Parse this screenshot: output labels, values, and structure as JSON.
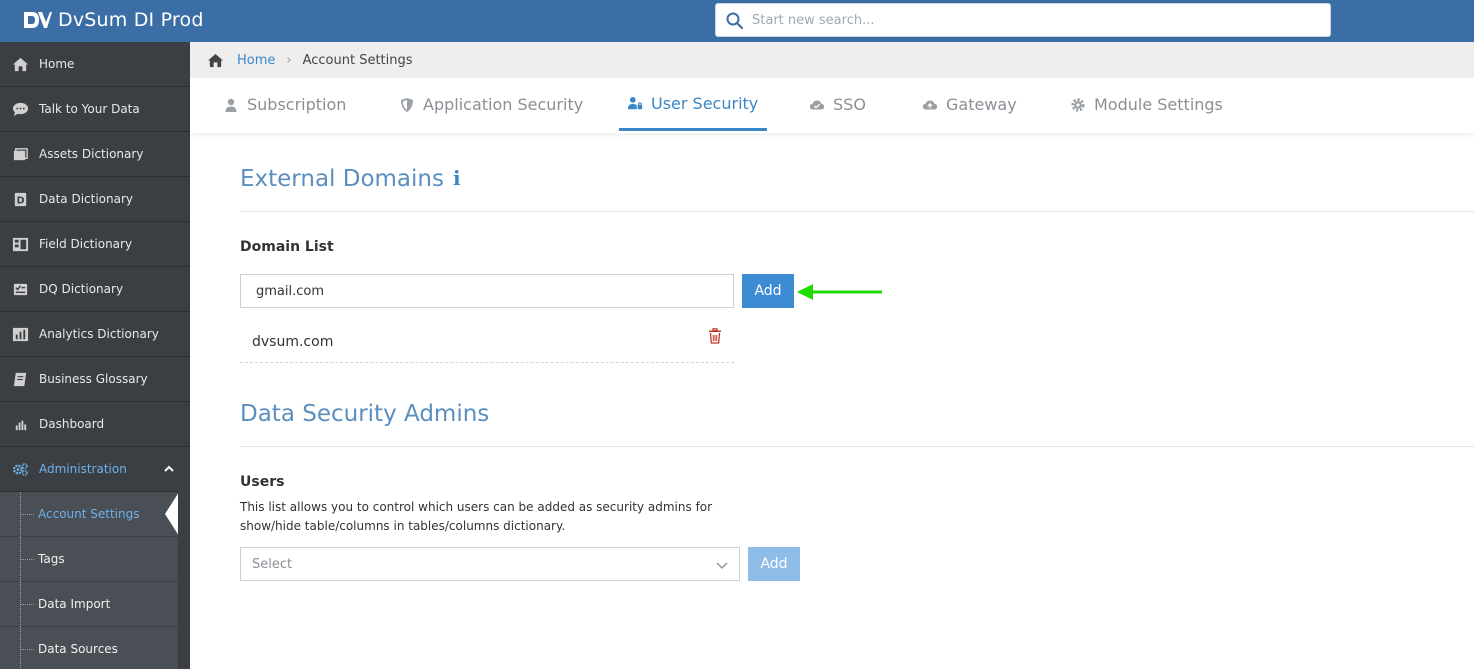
{
  "header": {
    "brand_title": "DvSum DI Prod",
    "search_placeholder": "Start new search..."
  },
  "sidebar": {
    "items": [
      {
        "label": "Home",
        "icon": "home-icon"
      },
      {
        "label": "Talk to Your Data",
        "icon": "chat-icon"
      },
      {
        "label": "Assets Dictionary",
        "icon": "assets-icon"
      },
      {
        "label": "Data Dictionary",
        "icon": "data-dictionary-icon"
      },
      {
        "label": "Field Dictionary",
        "icon": "field-dictionary-icon"
      },
      {
        "label": "DQ Dictionary",
        "icon": "dq-icon"
      },
      {
        "label": "Analytics Dictionary",
        "icon": "analytics-icon"
      },
      {
        "label": "Business Glossary",
        "icon": "book-icon"
      },
      {
        "label": "Dashboard",
        "icon": "bar-chart-icon"
      },
      {
        "label": "Administration",
        "icon": "gears-icon"
      }
    ],
    "sub_items": [
      {
        "label": "Account Settings"
      },
      {
        "label": "Tags"
      },
      {
        "label": "Data Import"
      },
      {
        "label": "Data Sources"
      }
    ]
  },
  "breadcrumb": {
    "home": "Home",
    "current": "Account Settings"
  },
  "tabs": [
    {
      "label": "Subscription",
      "icon": "user-icon"
    },
    {
      "label": "Application Security",
      "icon": "shield-icon"
    },
    {
      "label": "User Security",
      "icon": "user-lock-icon"
    },
    {
      "label": "SSO",
      "icon": "cloud-icon"
    },
    {
      "label": "Gateway",
      "icon": "cloud-upload-icon"
    },
    {
      "label": "Module Settings",
      "icon": "gear-icon"
    }
  ],
  "external_domains": {
    "title": "External Domains",
    "info_glyph": "i",
    "list_label": "Domain List",
    "input_value": "gmail.com",
    "add_label": "Add",
    "domains": [
      "dvsum.com"
    ]
  },
  "data_security_admins": {
    "title": "Data Security Admins",
    "users_label": "Users",
    "description": "This list allows you to control which users can be added as security admins for show/hide table/columns in tables/columns dictionary.",
    "select_placeholder": "Select",
    "add_label": "Add"
  },
  "colors": {
    "header_bg": "#3a6ea5",
    "sidebar_bg": "#3b3f44",
    "accent": "#3a87c8",
    "arrow": "#22dd00",
    "delete": "#c0392b"
  }
}
